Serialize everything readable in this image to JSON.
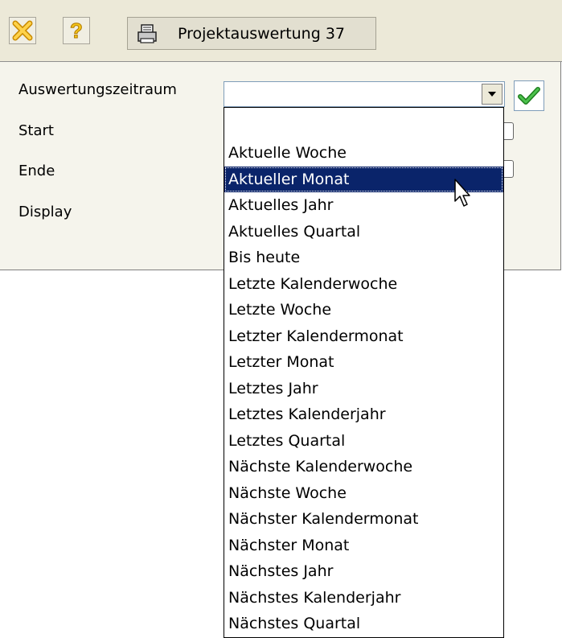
{
  "toolbar": {
    "close_icon": "close-x-icon",
    "help_icon": "help-question-icon",
    "print_icon": "printer-icon",
    "tab_title": "Projektauswertung 37"
  },
  "form": {
    "period_label": "Auswertungszeitraum",
    "period_value": "",
    "start_label": "Start",
    "end_label": "Ende",
    "display_label": "Display",
    "confirm_icon": "checkmark-icon"
  },
  "dropdown": {
    "selected": "Aktueller Monat",
    "options": [
      "",
      "Aktuelle Woche",
      "Aktueller Monat",
      "Aktuelles Jahr",
      "Aktuelles Quartal",
      "Bis heute",
      "Letzte Kalenderwoche",
      "Letzte Woche",
      "Letzter Kalendermonat",
      "Letzter Monat",
      "Letztes Jahr",
      "Letztes Kalenderjahr",
      "Letztes Quartal",
      "Nächste Kalenderwoche",
      "Nächste Woche",
      "Nächster Kalendermonat",
      "Nächster Monat",
      "Nächstes Jahr",
      "Nächstes Kalenderjahr",
      "Nächstes Quartal"
    ]
  },
  "colors": {
    "selection": "#0a246a",
    "toolbar_bg": "#ece9d8",
    "close_icon": "#f2b51b",
    "check_icon": "#2a9d2a"
  }
}
